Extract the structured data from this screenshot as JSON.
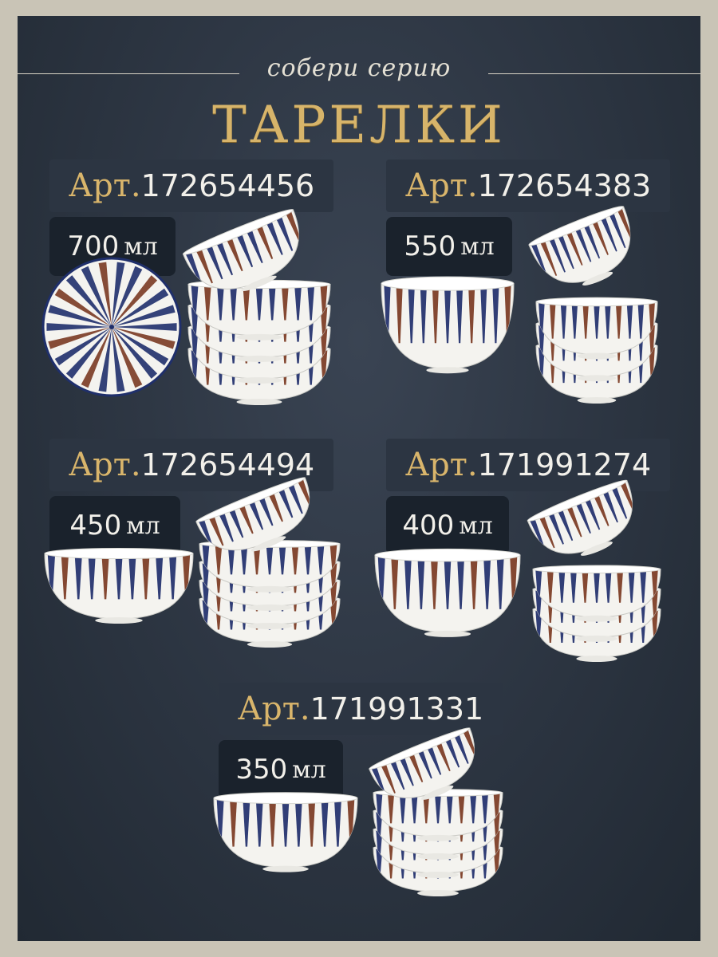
{
  "header": {
    "script_text": "собери серию",
    "title": "ТАРЕЛКИ"
  },
  "products": [
    {
      "art_prefix": "Арт.",
      "art_number": "172654456",
      "volume": "700",
      "unit": "мл"
    },
    {
      "art_prefix": "Арт.",
      "art_number": "172654383",
      "volume": "550",
      "unit": "мл"
    },
    {
      "art_prefix": "Арт.",
      "art_number": "172654494",
      "volume": "450",
      "unit": "мл"
    },
    {
      "art_prefix": "Арт.",
      "art_number": "171991274",
      "volume": "400",
      "unit": "мл"
    },
    {
      "art_prefix": "Арт.",
      "art_number": "171991331",
      "volume": "350",
      "unit": "мл"
    }
  ],
  "colors": {
    "background": "#2e3744",
    "gold": "#d7b46a",
    "stripe_blue": "#1f2f6b",
    "stripe_brown": "#7a3a22",
    "porcelain": "#f4f3ef"
  },
  "icons": [
    "plate-image",
    "bowl-image",
    "bowl-stack-image"
  ]
}
